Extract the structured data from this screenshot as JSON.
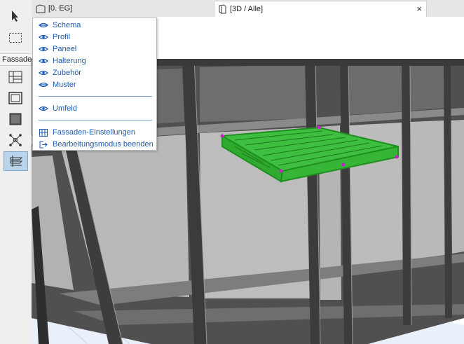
{
  "tabs": {
    "plan_label": "[0. EG]",
    "view3d_label": "[3D / Alle]",
    "close_symbol": "×"
  },
  "toolbox": {
    "section_label": "Fassade",
    "tools": [
      "arrow-select-icon",
      "marquee-icon",
      "facade-grid-icon",
      "facade-frame-icon",
      "facade-panel-icon",
      "facade-nodes-icon",
      "facade-edit-icon"
    ],
    "active_tool": "facade-edit-icon"
  },
  "menu": {
    "items": [
      {
        "label": "Schema",
        "icon": "eye-closed-icon"
      },
      {
        "label": "Profil",
        "icon": "eye-icon"
      },
      {
        "label": "Paneel",
        "icon": "eye-icon"
      },
      {
        "label": "Halterung",
        "icon": "eye-icon"
      },
      {
        "label": "Zubehör",
        "icon": "eye-icon"
      },
      {
        "label": "Muster",
        "icon": "eye-closed-icon"
      },
      {
        "label": "Umfeld",
        "icon": "eye-icon"
      },
      {
        "label": "Fassaden-Einstellungen",
        "icon": "facade-settings-icon"
      },
      {
        "label": "Bearbeitungsmodus beenden",
        "icon": "exit-icon"
      }
    ]
  },
  "colors": {
    "menu_text": "#1e5db3",
    "selection_green": "#38c038",
    "frame_dark": "#4a4a4a",
    "glass": "#b8b8b8"
  }
}
